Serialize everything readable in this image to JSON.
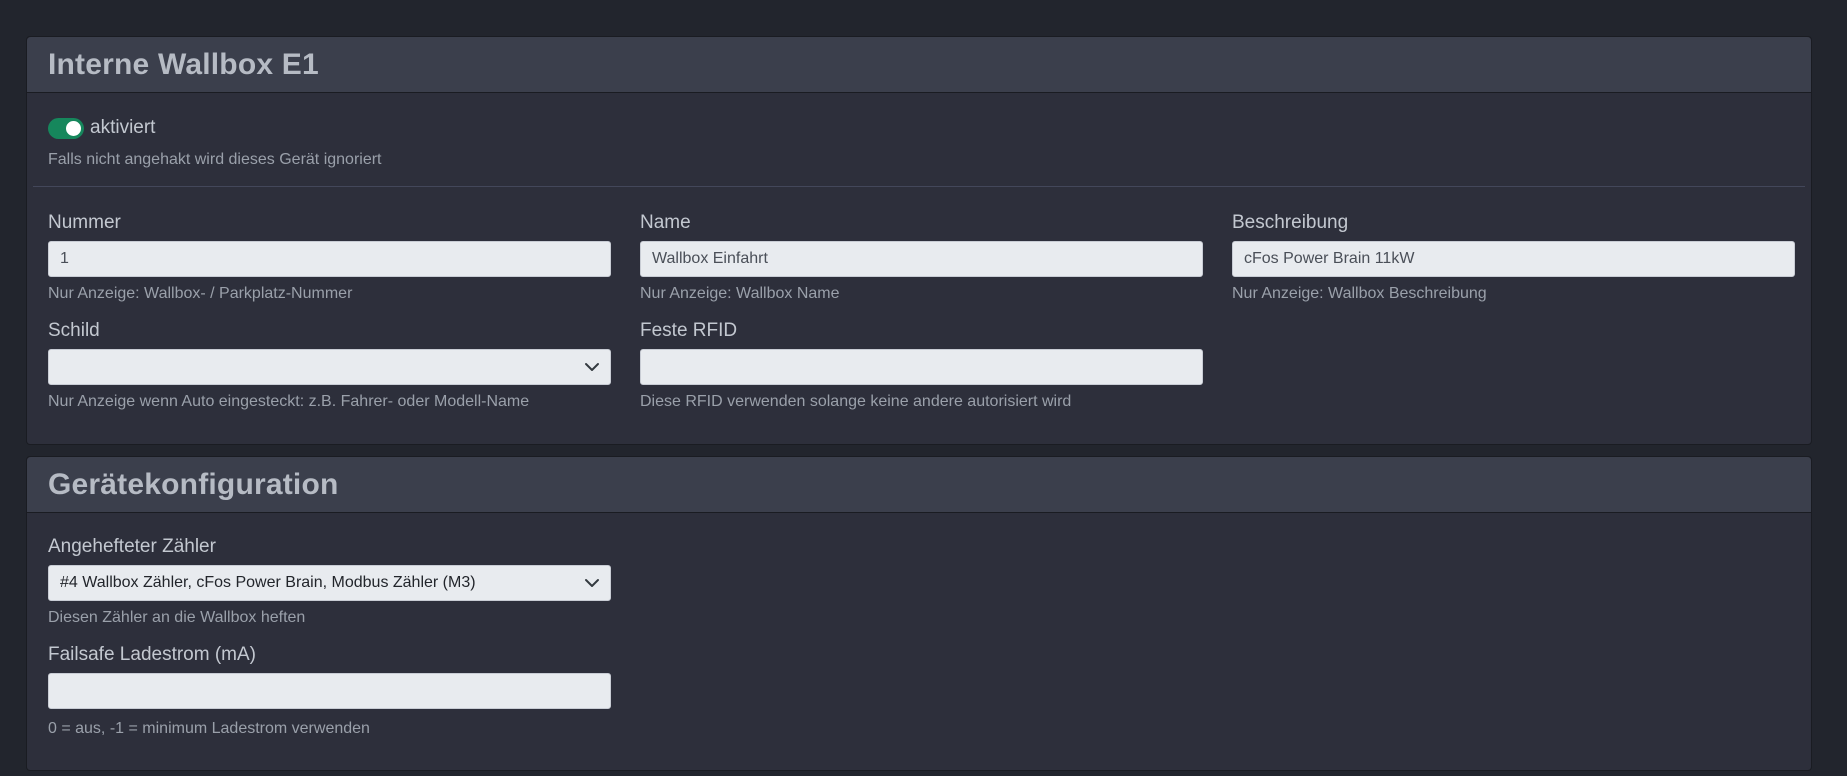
{
  "card1": {
    "title": "Interne Wallbox E1",
    "toggle_label": "aktiviert",
    "toggle_on": true,
    "toggle_help": "Falls nicht angehakt wird dieses Gerät ignoriert",
    "fields": {
      "nummer": {
        "label": "Nummer",
        "value": "1",
        "help": "Nur Anzeige: Wallbox- / Parkplatz-Nummer"
      },
      "name": {
        "label": "Name",
        "value": "Wallbox Einfahrt",
        "help": "Nur Anzeige: Wallbox Name"
      },
      "beschreibung": {
        "label": "Beschreibung",
        "value": "cFos Power Brain 11kW",
        "help": "Nur Anzeige: Wallbox Beschreibung"
      },
      "schild": {
        "label": "Schild",
        "value": "",
        "help": "Nur Anzeige wenn Auto eingesteckt: z.B. Fahrer- oder Modell-Name"
      },
      "rfid": {
        "label": "Feste RFID",
        "value": "",
        "help": "Diese RFID verwenden solange keine andere autorisiert wird"
      }
    }
  },
  "card2": {
    "title": "Gerätekonfiguration",
    "fields": {
      "zaehler": {
        "label": "Angehefteter Zähler",
        "value": "#4 Wallbox Zähler, cFos Power Brain, Modbus Zähler (M3)",
        "help": "Diesen Zähler an die Wallbox heften"
      },
      "failsafe": {
        "label": "Failsafe Ladestrom (mA)",
        "value": "",
        "help": "0 = aus, -1 = minimum Ladestrom verwenden"
      }
    }
  },
  "colors": {
    "background": "#22252d",
    "card": "#2d2f3b",
    "card_header": "#3b3f4c",
    "toggle_on": "#16875c",
    "input_bg": "#e8ebef"
  },
  "icons": {
    "select_chevron": "chevron-down-icon"
  }
}
